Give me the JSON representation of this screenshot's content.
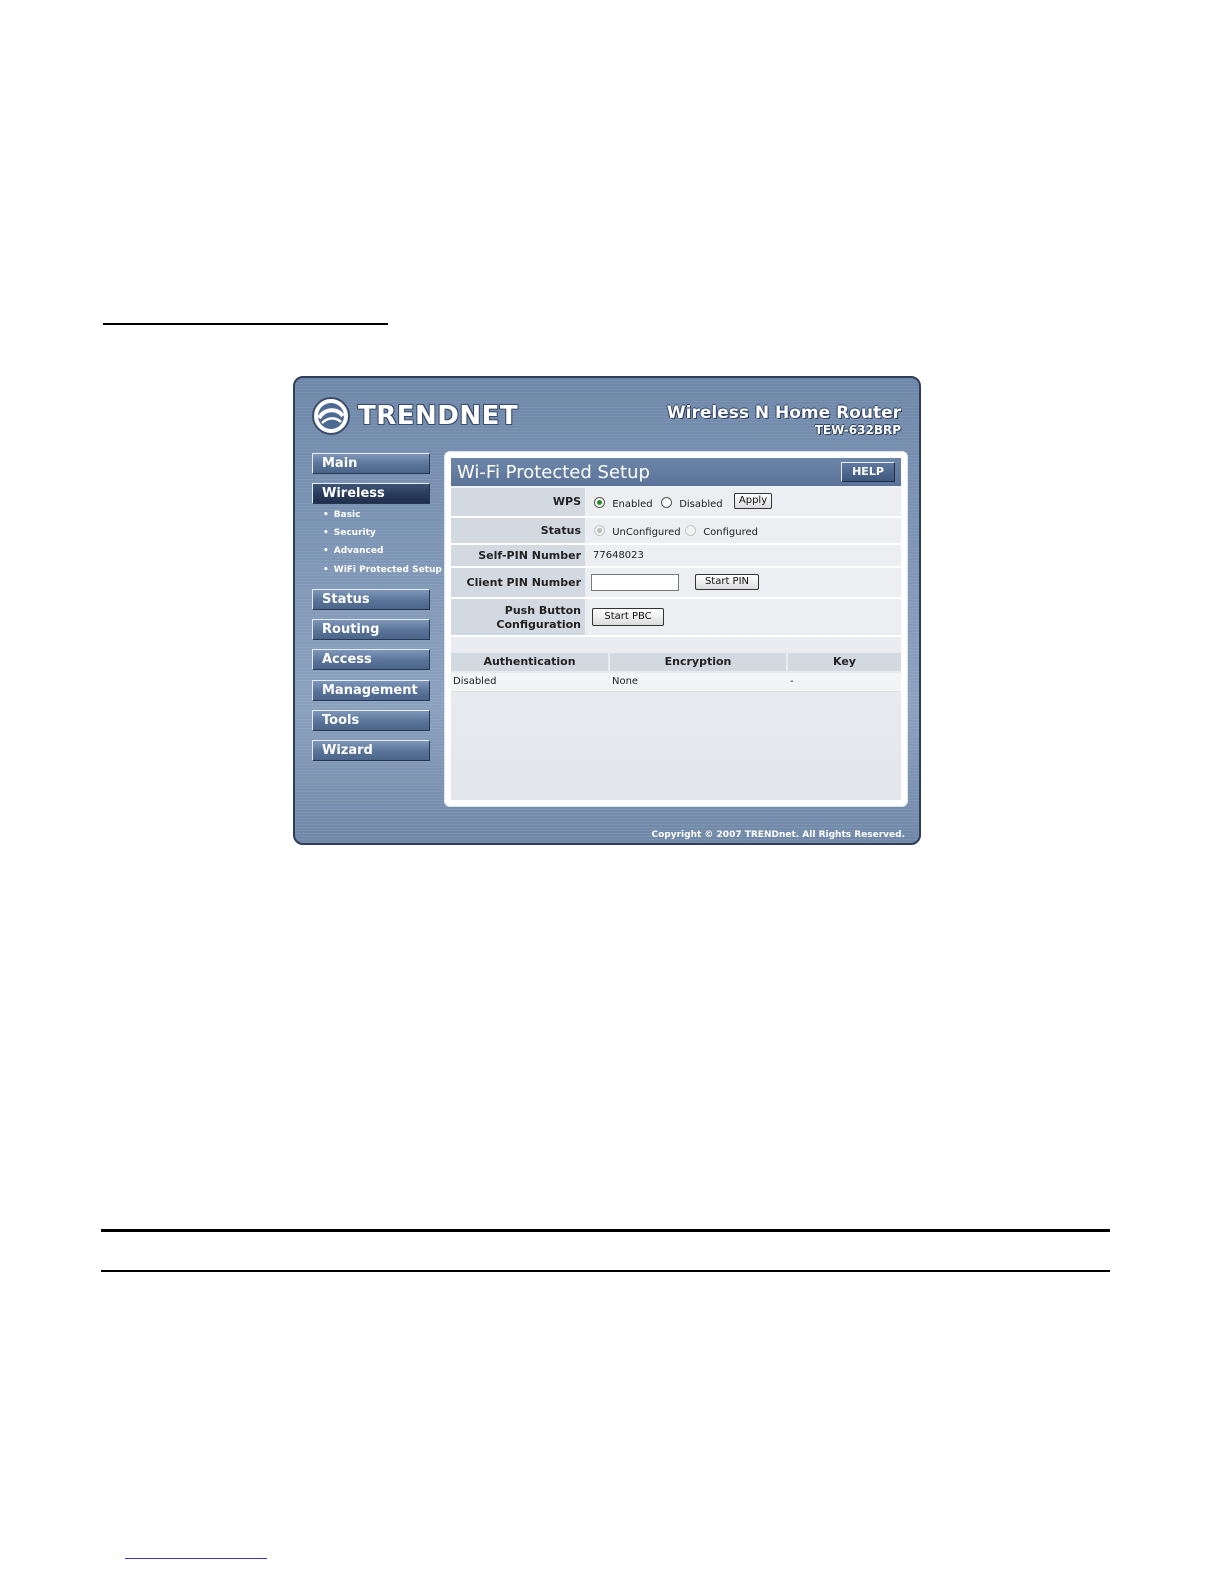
{
  "router": {
    "brand": "TRENDNET",
    "product_name": "Wireless N Home Router",
    "model": "TEW-632BRP",
    "copyright": "Copyright © 2007 TRENDnet. All Rights Reserved."
  },
  "sidebar": {
    "items": [
      {
        "label": "Main"
      },
      {
        "label": "Wireless",
        "active": true
      },
      {
        "label": "Status"
      },
      {
        "label": "Routing"
      },
      {
        "label": "Access"
      },
      {
        "label": "Management"
      },
      {
        "label": "Tools"
      },
      {
        "label": "Wizard"
      }
    ],
    "wireless_sub": [
      "Basic",
      "Security",
      "Advanced",
      "WiFi Protected Setup"
    ],
    "bullet": "•"
  },
  "page": {
    "title": "Wi-Fi Protected Setup",
    "help_label": "HELP"
  },
  "form": {
    "wps": {
      "label": "WPS",
      "enabled_label": "Enabled",
      "disabled_label": "Disabled",
      "selected": "Enabled",
      "apply_label": "Apply"
    },
    "status": {
      "label": "Status",
      "unconfigured_label": "UnConfigured",
      "configured_label": "Configured",
      "selected": "UnConfigured"
    },
    "self_pin": {
      "label": "Self-PIN Number",
      "value": "77648023"
    },
    "client_pin": {
      "label": "Client PIN Number",
      "value": "",
      "button_label": "Start PIN"
    },
    "push_button": {
      "label_line1": "Push Button",
      "label_line2": "Configuration",
      "button_label": "Start PBC"
    }
  },
  "security_table": {
    "headers": [
      "Authentication",
      "Encryption",
      "Key"
    ],
    "rows": [
      [
        "Disabled",
        "None",
        "-"
      ]
    ]
  },
  "colors": {
    "frame": "#7b93b3",
    "title_bar": "#5a7398",
    "label_cell": "#d3d9e1"
  }
}
